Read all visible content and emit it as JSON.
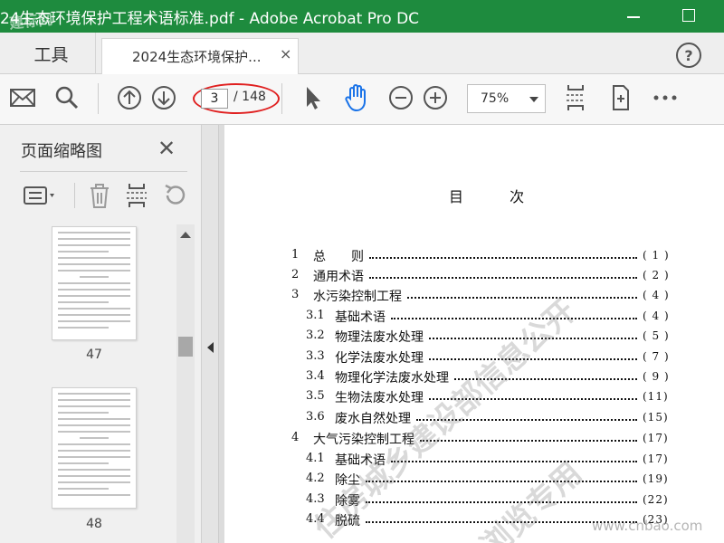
{
  "window": {
    "title": "24生态环境保护工程术语标准.pdf - Adobe Acrobat Pro DC",
    "overlay_mark": "建标网"
  },
  "tabs": {
    "tools_label": "工具",
    "document_label": "2024生态环境保护...",
    "close_glyph": "×",
    "help_glyph": "?"
  },
  "toolbar": {
    "icons": [
      "mail-icon",
      "search-icon",
      "prev-page-icon",
      "next-page-icon",
      "select-arrow-icon",
      "hand-tool-icon",
      "zoom-out-icon",
      "zoom-in-icon",
      "fit-page-icon",
      "rotate-view-icon",
      "more-icon"
    ],
    "current_page": "3",
    "total_pages": "/ 148",
    "zoom": "75%"
  },
  "sidebar": {
    "title": "页面缩略图",
    "close_glyph": "✕",
    "tool_icons": [
      "thumbnail-options-icon",
      "delete-page-icon",
      "extract-pages-icon",
      "rotate-page-icon"
    ],
    "thumbnails": [
      {
        "page": "47"
      },
      {
        "page": "48"
      }
    ]
  },
  "document": {
    "heading": [
      "目",
      "次"
    ],
    "toc": [
      {
        "num": "1",
        "title": "总　　则",
        "page": "( 1 )"
      },
      {
        "num": "2",
        "title": "通用术语",
        "page": "( 2 )"
      },
      {
        "num": "3",
        "title": "水污染控制工程",
        "page": "( 4 )"
      },
      {
        "num": "3.1",
        "title": "基础术语",
        "page": "( 4 )"
      },
      {
        "num": "3.2",
        "title": "物理法废水处理",
        "page": "( 5 )"
      },
      {
        "num": "3.3",
        "title": "化学法废水处理",
        "page": "( 7 )"
      },
      {
        "num": "3.4",
        "title": "物理化学法废水处理",
        "page": "( 9 )"
      },
      {
        "num": "3.5",
        "title": "生物法废水处理",
        "page": "(11)"
      },
      {
        "num": "3.6",
        "title": "废水自然处理",
        "page": "(15)"
      },
      {
        "num": "4",
        "title": "大气污染控制工程",
        "page": "(17)"
      },
      {
        "num": "4.1",
        "title": "基础术语",
        "page": "(17)"
      },
      {
        "num": "4.2",
        "title": "除尘",
        "page": "(19)"
      },
      {
        "num": "4.3",
        "title": "除雾",
        "page": "(22)"
      },
      {
        "num": "4.4",
        "title": "脱硫",
        "page": "(23)"
      }
    ],
    "watermark_1": "住房城乡建设部信息公开",
    "watermark_2": "浏览专用",
    "corner_mark": "www.cnbao.com"
  },
  "colors": {
    "titlebar": "#1e8b3e",
    "active_tool": "#1a73e8",
    "annotation": "#e02020"
  }
}
